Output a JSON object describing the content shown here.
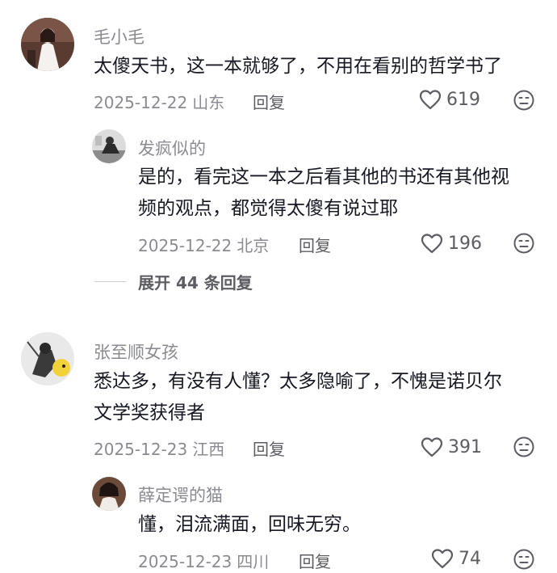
{
  "comments": [
    {
      "author": "毛小毛",
      "text": "太傻天书，这一本就够了，不用在看别的哲学书了",
      "date": "2025-12-22",
      "location": "山东",
      "reply_label": "回复",
      "likes": "619"
    },
    {
      "author": "发疯似的",
      "text_line1": "是的，看完这一本之后看其他的书还有其他视",
      "text_line2": "频的观点，都觉得太傻有说过耶",
      "date": "2025-12-22",
      "location": "北京",
      "reply_label": "回复",
      "likes": "196"
    },
    {
      "author": "张至顺女孩",
      "text_line1": "悉达多，有没有人懂？太多隐喻了，不愧是诺贝尔",
      "text_line2": "文学奖获得者",
      "date": "2025-12-23",
      "location": "江西",
      "reply_label": "回复",
      "likes": "391"
    },
    {
      "author": "薛定谔的猫",
      "text": "懂，泪流满面，回味无穷。",
      "date": "2025-12-23",
      "location": "四川",
      "reply_label": "回复",
      "likes": "74"
    }
  ],
  "expand_replies": "展开 44 条回复",
  "icons": {
    "like": "heart-outline-icon",
    "dislike": "neutral-face-icon"
  },
  "colors": {
    "text": "#161823",
    "muted": "#8a8b91",
    "action": "#5c5d63"
  }
}
